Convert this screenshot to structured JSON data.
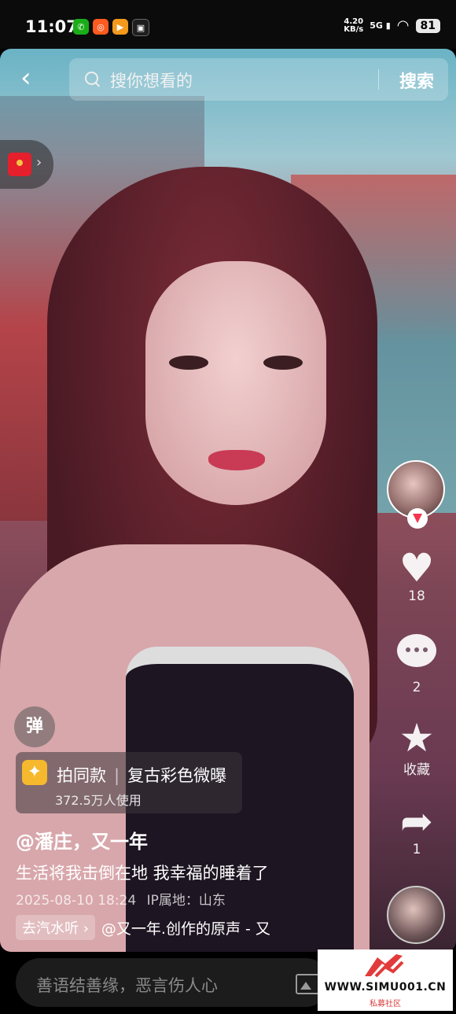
{
  "status_bar": {
    "time": "11:07",
    "net_speed": "4.20",
    "net_unit": "KB/s",
    "signal": "5G",
    "battery": "81",
    "app_icons": [
      "wechat-icon",
      "app-icon-orange",
      "video-app-icon",
      "gift-app-icon"
    ]
  },
  "search": {
    "placeholder": "搜你想看的",
    "button_label": "搜索"
  },
  "rail": {
    "like_count": "18",
    "comment_count": "2",
    "favorite_label": "收藏",
    "share_count": "1"
  },
  "danmu_label": "弹",
  "effect": {
    "title": "拍同款",
    "name": "复古彩色微曝",
    "users": "372.5万人使用"
  },
  "post": {
    "author": "@潘庄，又一年",
    "caption": "生活将我击倒在地 我幸福的睡着了",
    "date": "2025-08-10 18:24",
    "ip_location": "IP属地：山东",
    "music_chip": "去汽水听",
    "music_title": "@又一年.创作的原声 - 又"
  },
  "comment_box": {
    "placeholder": "善语结善缘，恶言伤人心"
  },
  "watermark": {
    "url": "WWW.SIMU001.CN",
    "sub": "私募社区"
  },
  "colors": {
    "accent_red": "#f5344f",
    "effect_yellow": "#f6b82c"
  }
}
